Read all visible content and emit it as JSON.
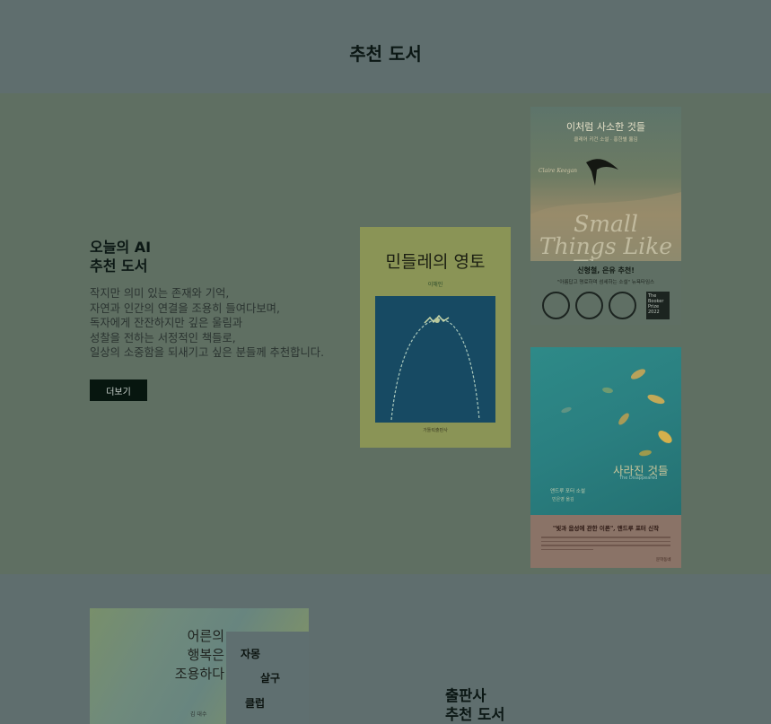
{
  "page": {
    "title": "추천 도서"
  },
  "ai_section": {
    "heading_line1": "오늘의 AI",
    "heading_line2": "추천 도서",
    "description": [
      "작지만 의미 있는 존재와 기억,",
      "자연과 인간의 연결을 조용히 들여다보며,",
      "독자에게 잔잔하지만 깊은 울림과",
      "성찰을 전하는 서정적인 책들로,",
      "일상의 소중함을 되새기고 싶은 분들께 추천합니다."
    ],
    "more_button": "더보기"
  },
  "books": [
    {
      "title": "민들레의 영토",
      "author": "이해인",
      "publisher": "가톨릭출판사",
      "art_color": "#174a63"
    },
    {
      "title": "이처럼 사소한 것들",
      "subtitle": "클레어 키건 소설 · 홍한별 옮김",
      "author_en": "Claire Keegan",
      "title_en": "Small Things Like These",
      "blurb": "신형철, 은유 추천!",
      "quote": "\"아름답고 명료하며 섬세하는 소설\" 뉴욕타임스",
      "booker": "The Booker Prize 2022"
    },
    {
      "title": "사라진 것들",
      "title_en": "The Disappeared",
      "author": "앤드루 포터 소설",
      "translator": "민은영 옮김",
      "blurb": "\"빛과 음성에 관한 이론\", 앤드루 포터 신작",
      "publisher": "문학동네"
    },
    {
      "title_lines": [
        "어른의",
        "행복은",
        "조용하다"
      ],
      "author": "김 대수"
    }
  ],
  "publisher_keywords": [
    "자몽",
    "살구",
    "클럽"
  ],
  "publisher_section": {
    "heading_line1": "출판사",
    "heading_line2": "추천 도서"
  }
}
